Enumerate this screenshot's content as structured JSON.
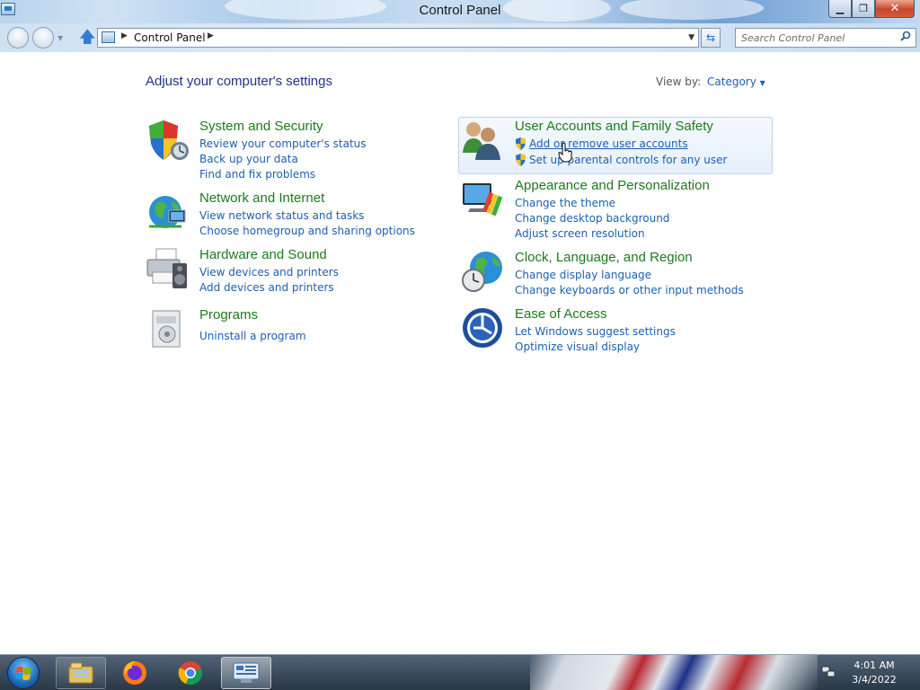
{
  "window": {
    "title": "Control Panel",
    "minimize_glyph": "▁",
    "maximize_glyph": "❐",
    "close_glyph": "✕"
  },
  "address_bar": {
    "breadcrumb": "Control Panel",
    "search_placeholder": "Search Control Panel"
  },
  "main": {
    "heading": "Adjust your computer's settings",
    "view_by_label": "View by:",
    "view_by_value": "Category"
  },
  "categories": [
    {
      "title": "System and Security",
      "icon": "shield-icon",
      "links": [
        "Review your computer's status",
        "Back up your data",
        "Find and fix problems"
      ]
    },
    {
      "title": "Network and Internet",
      "icon": "network-globe-icon",
      "links": [
        "View network status and tasks",
        "Choose homegroup and sharing options"
      ]
    },
    {
      "title": "Hardware and Sound",
      "icon": "printer-speaker-icon",
      "links": [
        "View devices and printers",
        "Add devices and printers"
      ]
    },
    {
      "title": "Programs",
      "icon": "programs-icon",
      "links": [
        "Uninstall a program"
      ]
    },
    {
      "title": "User Accounts and Family Safety",
      "icon": "users-icon",
      "links": [
        "Add or remove user accounts",
        "Set up parental controls for any user"
      ]
    },
    {
      "title": "Appearance and Personalization",
      "icon": "monitor-paint-icon",
      "links": [
        "Change the theme",
        "Change desktop background",
        "Adjust screen resolution"
      ]
    },
    {
      "title": "Clock, Language, and Region",
      "icon": "clock-globe-icon",
      "links": [
        "Change display language",
        "Change keyboards or other input methods"
      ]
    },
    {
      "title": "Ease of Access",
      "icon": "ease-of-access-icon",
      "links": [
        "Let Windows suggest settings",
        "Optimize visual display"
      ]
    }
  ],
  "taskbar": {
    "items": [
      "windows-explorer-icon",
      "firefox-icon",
      "chrome-icon",
      "control-panel-icon"
    ],
    "clock_time": "4:01 AM",
    "clock_date": "3/4/2022"
  },
  "colors": {
    "link": "#1e5fb0",
    "category_title": "#1e7a1e",
    "heading": "#1e3287"
  }
}
